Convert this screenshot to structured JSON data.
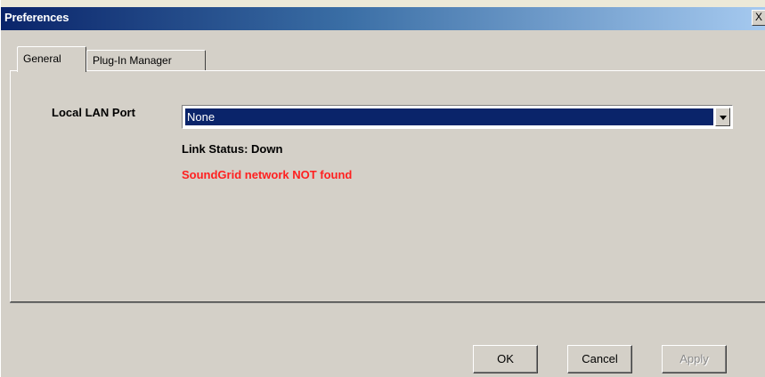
{
  "window": {
    "title": "Preferences",
    "close_label": "X"
  },
  "tabs": [
    {
      "label": "General",
      "active": true
    },
    {
      "label": "Plug-In Manager",
      "active": false
    }
  ],
  "general": {
    "port_label": "Local LAN Port",
    "port_selected": "None",
    "link_status": "Link Status: Down",
    "network_message": "SoundGrid network NOT found"
  },
  "buttons": {
    "ok": "OK",
    "cancel": "Cancel",
    "apply": "Apply"
  },
  "colors": {
    "error_text": "#ff2020",
    "selection": "#0a246a",
    "dialog_bg": "#d4d0c8"
  }
}
